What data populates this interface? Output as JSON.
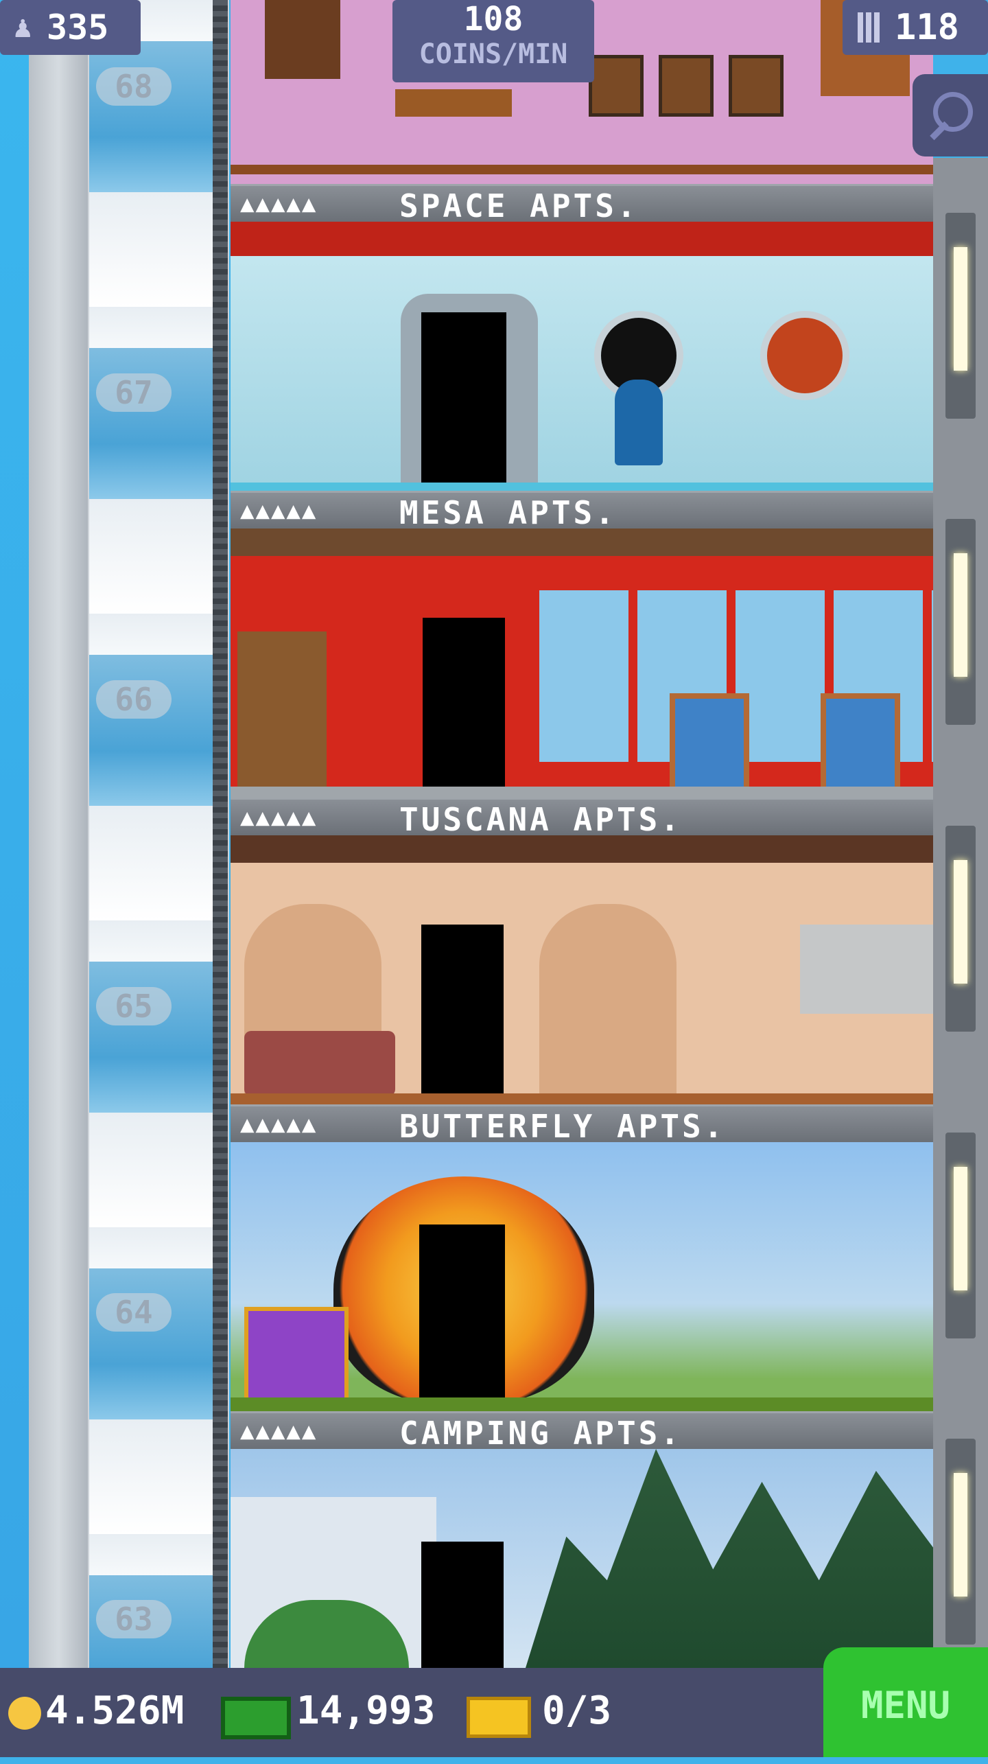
{
  "hud": {
    "population": "335",
    "coins_per_min_value": "108",
    "coins_per_min_label": "COINS/MIN",
    "floors": "118"
  },
  "shaft_floor_numbers": [
    "68",
    "67",
    "66",
    "65",
    "64",
    "63"
  ],
  "floors": [
    {
      "name": "SPACE APTS.",
      "residents": "▲▲▲▲▲"
    },
    {
      "name": "MESA APTS.",
      "residents": "▲▲▲▲▲"
    },
    {
      "name": "TUSCANA APTS.",
      "residents": "▲▲▲▲▲"
    },
    {
      "name": "BUTTERFLY APTS.",
      "residents": "▲▲▲▲▲"
    },
    {
      "name": "CAMPING APTS.",
      "residents": "▲▲▲▲▲"
    }
  ],
  "bottom": {
    "coins": "4.526M",
    "bux": "14,993",
    "tickets": "0/3",
    "menu_label": "MENU"
  },
  "colors": {
    "hud_pill": "#545a87",
    "bottom_bar": "#474b6a",
    "menu_green": "#2fc231",
    "space_wall": "#bfe3ec",
    "mesa_wall": "#d4281c",
    "tuscana_wall": "#e9c3a4",
    "butterfly_sky": "#7fb7ea",
    "camping_sky": "#b3d3ee"
  },
  "icons": [
    "person-icon",
    "building-icon",
    "search-icon",
    "coin-icon",
    "bux-icon",
    "ticket-icon"
  ]
}
